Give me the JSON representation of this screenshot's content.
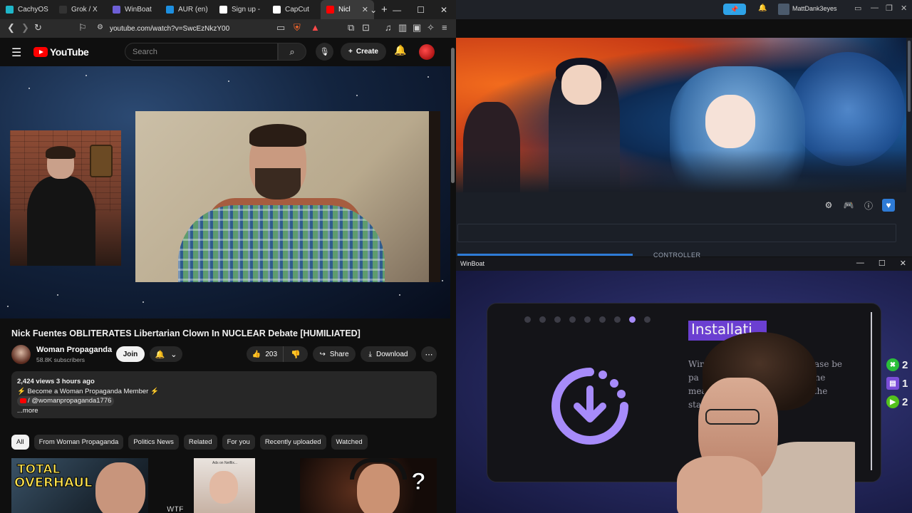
{
  "browser": {
    "tabs": [
      {
        "label": "CachyOS",
        "color": "#1fb6c8"
      },
      {
        "label": "Grok / X",
        "color": "#222222"
      },
      {
        "label": "WinBoat",
        "color": "#6d5fd6"
      },
      {
        "label": "AUR (en)",
        "color": "#1d8fe0"
      },
      {
        "label": "Sign up -",
        "color": "#ffffff"
      },
      {
        "label": "CapCut",
        "color": "#ffffff"
      },
      {
        "label": "Nicl",
        "color": "#ff0000"
      }
    ],
    "url": "youtube.com/watch?v=SwcEzNkzY00"
  },
  "youtube": {
    "logo": "YouTube",
    "search_placeholder": "Search",
    "create_label": "Create",
    "video_title": "Nick Fuentes OBLITERATES Libertarian Clown In NUCLEAR Debate [HUMILIATED]",
    "channel_name": "Woman Propaganda",
    "subscribers": "58.8K subscribers",
    "join_label": "Join",
    "likes": "203",
    "share_label": "Share",
    "download_label": "Download",
    "description": {
      "stats": "2,424 views  3 hours ago",
      "line1": "⚡ Become a Woman Propaganda Member ⚡",
      "line2": "/ @womanpropaganda1776",
      "more": "...more"
    },
    "chips": [
      "All",
      "From Woman Propaganda",
      "Politics News",
      "Related",
      "For you",
      "Recently uploaded",
      "Watched"
    ],
    "thumbnails": {
      "t1_line1": "TOTAL",
      "t1_line2": "OVERHAUL",
      "t2_ads": "Ads on Netflix...",
      "t2_text": "WTF",
      "t3_text": "?"
    }
  },
  "system_bar": {
    "username": "MattDank3eyes"
  },
  "game_launcher": {
    "controller_tab": "CONTROLLER"
  },
  "winboat": {
    "window_title": "WinBoat",
    "heading": "Installati",
    "body_line1": "Win                          lows. Please be",
    "body_line2": "pa                            hour. In the",
    "body_line3": "mea                          d check the",
    "body_line4": "stat",
    "step_total": 9,
    "step_current": 8
  },
  "stream_stats": [
    {
      "platform": "xbox-icon",
      "count": "2",
      "color": "#2bbf3a"
    },
    {
      "platform": "twitch-icon",
      "count": "1",
      "color": "#7b4ed8"
    },
    {
      "platform": "kick-icon",
      "count": "2",
      "color": "#53c21c"
    }
  ]
}
